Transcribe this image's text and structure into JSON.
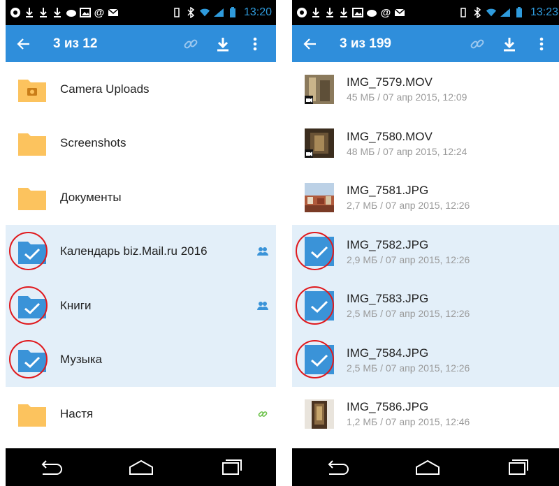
{
  "colors": {
    "accent": "#2f8edb",
    "selected_bg": "#e3eff9",
    "folder": "#fcc35e",
    "folder_selected": "#3a93d8",
    "highlight_circle": "#e0191d"
  },
  "left": {
    "status_time": "13:20",
    "title": "3 из 12",
    "items": [
      {
        "name": "Camera Uploads",
        "icon": "camera-folder-icon",
        "selected": false
      },
      {
        "name": "Screenshots",
        "icon": "folder-icon",
        "selected": false
      },
      {
        "name": "Документы",
        "icon": "folder-icon",
        "selected": false
      },
      {
        "name": "Календарь biz.Mail.ru 2016",
        "icon": "folder-check-icon",
        "selected": true,
        "badge": "shared-users-icon"
      },
      {
        "name": "Книги",
        "icon": "folder-check-icon",
        "selected": true,
        "badge": "shared-users-icon"
      },
      {
        "name": "Музыка",
        "icon": "folder-check-icon",
        "selected": true
      },
      {
        "name": "Настя",
        "icon": "folder-icon",
        "selected": false,
        "badge": "link-icon"
      }
    ]
  },
  "right": {
    "status_time": "13:23",
    "title": "3 из 199",
    "items": [
      {
        "name": "IMG_7579.MOV",
        "meta": "45 МБ / 07 апр 2015, 12:09",
        "selected": false,
        "icon": "video-thumbnail"
      },
      {
        "name": "IMG_7580.MOV",
        "meta": "48 МБ / 07 апр 2015, 12:24",
        "selected": false,
        "icon": "video-thumbnail"
      },
      {
        "name": "IMG_7581.JPG",
        "meta": "2,7 МБ / 07 апр 2015, 12:26",
        "selected": false,
        "icon": "photo-thumbnail"
      },
      {
        "name": "IMG_7582.JPG",
        "meta": "2,9 МБ / 07 апр 2015, 12:26",
        "selected": true,
        "icon": "check-thumbnail"
      },
      {
        "name": "IMG_7583.JPG",
        "meta": "2,5 МБ / 07 апр 2015, 12:26",
        "selected": true,
        "icon": "check-thumbnail"
      },
      {
        "name": "IMG_7584.JPG",
        "meta": "2,5 МБ / 07 апр 2015, 12:26",
        "selected": true,
        "icon": "check-thumbnail"
      },
      {
        "name": "IMG_7586.JPG",
        "meta": "1,2 МБ / 07 апр 2015, 12:46",
        "selected": false,
        "icon": "photo-thumbnail"
      }
    ]
  }
}
